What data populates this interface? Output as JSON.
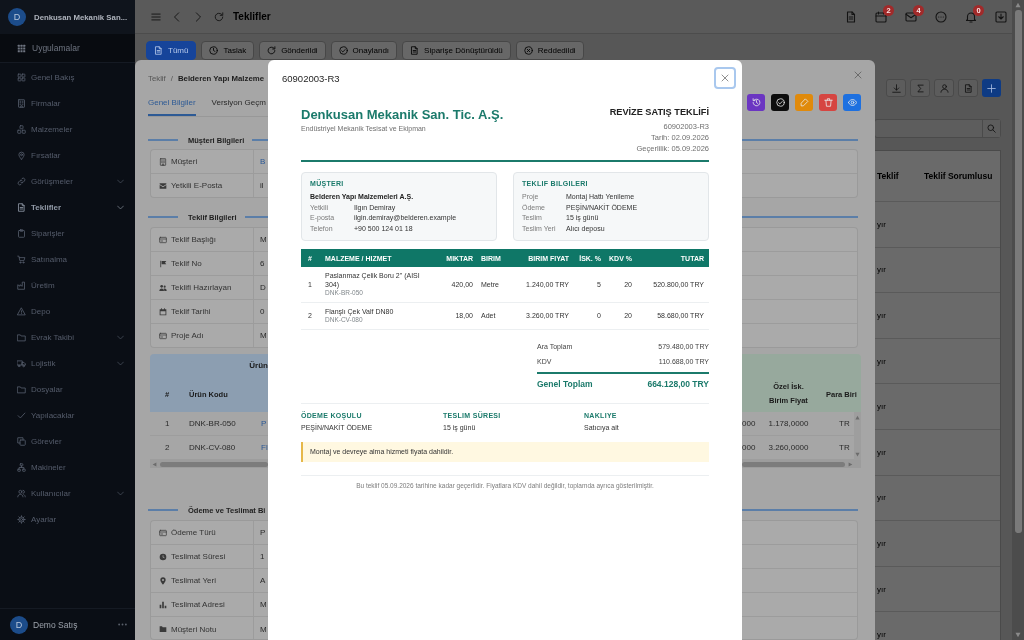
{
  "sidebar": {
    "brand": {
      "initial": "D",
      "name": "Denkusan Mekanik San..."
    },
    "apps_label": "Uygulamalar",
    "items": [
      {
        "label": "Genel Bakış",
        "selected": false,
        "has_submenu": false
      },
      {
        "label": "Firmalar",
        "selected": false,
        "has_submenu": false
      },
      {
        "label": "Malzemeler",
        "selected": false,
        "has_submenu": false
      },
      {
        "label": "Fırsatlar",
        "selected": false,
        "has_submenu": false
      },
      {
        "label": "Görüşmeler",
        "selected": false,
        "has_submenu": true
      },
      {
        "label": "Teklifler",
        "selected": true,
        "has_submenu": true
      },
      {
        "label": "Siparişler",
        "selected": false,
        "has_submenu": false
      },
      {
        "label": "Satınalma",
        "selected": false,
        "has_submenu": false
      },
      {
        "label": "Üretim",
        "selected": false,
        "has_submenu": false
      },
      {
        "label": "Depo",
        "selected": false,
        "has_submenu": false
      },
      {
        "label": "Evrak Takibi",
        "selected": false,
        "has_submenu": true
      },
      {
        "label": "Lojistik",
        "selected": false,
        "has_submenu": true
      },
      {
        "label": "Dosyalar",
        "selected": false,
        "has_submenu": false
      },
      {
        "label": "Yapılacaklar",
        "selected": false,
        "has_submenu": false
      },
      {
        "label": "Görevler",
        "selected": false,
        "has_submenu": false
      },
      {
        "label": "Makineler",
        "selected": false,
        "has_submenu": false
      },
      {
        "label": "Kullanıcılar",
        "selected": false,
        "has_submenu": true
      },
      {
        "label": "Ayarlar",
        "selected": false,
        "has_submenu": false
      }
    ],
    "user": {
      "initial": "D",
      "name": "Demo Satış"
    }
  },
  "topbar": {
    "title": "Teklifler",
    "badges": [
      "2",
      "4",
      "0"
    ]
  },
  "status_tabs": [
    {
      "label": "Tümü",
      "selected": true
    },
    {
      "label": "Taslak",
      "selected": false
    },
    {
      "label": "Gönderildi",
      "selected": false
    },
    {
      "label": "Onaylandı",
      "selected": false
    },
    {
      "label": "Siparişe Dönüştürüldü",
      "selected": false
    },
    {
      "label": "Reddedildi",
      "selected": false
    }
  ],
  "quote_list": {
    "columns": [
      "Teklif",
      "Teklif Sorumlusu"
    ],
    "rows": [
      {
        "cells": [
          "yır"
        ]
      },
      {
        "cells": [
          "yır"
        ]
      },
      {
        "cells": [
          "yır"
        ]
      },
      {
        "cells": [
          "yır"
        ]
      },
      {
        "cells": [
          "yır"
        ]
      },
      {
        "cells": [
          "yır"
        ]
      },
      {
        "cells": [
          "yır"
        ]
      },
      {
        "cells": [
          "yır"
        ]
      },
      {
        "cells": [
          "yır"
        ]
      },
      {
        "cells": [
          "yır"
        ]
      }
    ]
  },
  "drawer": {
    "breadcrumb": {
      "root": "Teklif",
      "separator": "/",
      "current": "Belderen Yapı Malzeme"
    },
    "tabs": [
      {
        "label": "Genel Bilgiler",
        "selected": true
      },
      {
        "label": "Versiyon Geçm",
        "selected": false
      }
    ],
    "action_buttons": [
      {
        "color": "#6b35c2"
      },
      {
        "color": "#0d0d0d"
      },
      {
        "color": "#e08a0b"
      },
      {
        "color": "#d64541"
      },
      {
        "color": "#1d70e0"
      }
    ],
    "sections": [
      {
        "title": "Müşteri Bilgileri",
        "fields": [
          {
            "label": "Müşteri",
            "value": "B",
            "link": true
          },
          {
            "label": "Yetkili E-Posta",
            "value": "il",
            "link": false
          }
        ]
      },
      {
        "title": "Teklif Bilgileri",
        "fields": [
          {
            "label": "Teklif Başlığı",
            "value": "M",
            "link": false
          },
          {
            "label": "Teklif No",
            "value": "6",
            "link": false
          },
          {
            "label": "Teklifi Hazırlayan",
            "value": "D",
            "link": false
          },
          {
            "label": "Teklif Tarihi",
            "value": "0",
            "link": false
          },
          {
            "label": "Proje Adı",
            "value": "M",
            "link": false
          }
        ]
      }
    ],
    "products": {
      "title": "Ürün",
      "columns": [
        "#",
        "Ürün Kodu",
        "Özel İsk. Birim Fiyat",
        "Para Biri"
      ],
      "rows": [
        {
          "no": "1",
          "code": "DNK-BR-050",
          "column_3": "P",
          "column_4": "000",
          "special_price": "1.178,0000",
          "currency": "TR"
        },
        {
          "no": "2",
          "code": "DNK-CV-080",
          "column_3": "Fl",
          "column_4": "000",
          "special_price": "3.260,0000",
          "currency": "TR"
        }
      ]
    },
    "payment_section": {
      "title": "Ödeme ve Teslimat Bi",
      "fields": [
        {
          "label": "Ödeme Türü",
          "value": "P",
          "link": false
        },
        {
          "label": "Teslimat Süresi",
          "value": "1",
          "link": false
        },
        {
          "label": "Teslimat Yeri",
          "value": "A",
          "link": false
        },
        {
          "label": "Teslimat Adresi",
          "value": "M",
          "link": false
        },
        {
          "label": "Müşteri Notu",
          "value": "M",
          "link": false
        }
      ]
    }
  },
  "modal": {
    "title": "60902003-R3",
    "company": {
      "name": "Denkusan Mekanik San. Tic. A.Ş.",
      "tagline": "Endüstriyel Mekanik Tesisat ve Ekipman"
    },
    "document": {
      "title": "REVİZE SATIŞ TEKLİFİ",
      "number": "60902003-R3",
      "date": "Tarih: 02.09.2026",
      "validity": "Geçerlilik: 05.09.2026"
    },
    "info_cards": [
      {
        "title": "MÜŞTERI",
        "headline": "Belderen Yapı Malzemeleri A.Ş.",
        "rows": [
          {
            "label": "Yetkili",
            "value": "Ilgın Demiray"
          },
          {
            "label": "E-posta",
            "value": "ilgin.demiray@belderen.example"
          },
          {
            "label": "Telefon",
            "value": "+90 500 124 01 18"
          }
        ]
      },
      {
        "title": "TEKLIF BILGILERI",
        "rows": [
          {
            "label": "Proje",
            "value": "Montaj Hattı Yenileme"
          },
          {
            "label": "Ödeme",
            "value": "PEŞİN/NAKİT ÖDEME"
          },
          {
            "label": "Teslim",
            "value": "15 iş günü"
          },
          {
            "label": "Teslim Yeri",
            "value": "Alıcı deposu"
          }
        ]
      }
    ],
    "items_table": {
      "columns": [
        "#",
        "MALZEME / HIZMET",
        "MIKTAR",
        "BIRIM",
        "BIRIM FIYAT",
        "İSK. %",
        "KDV %",
        "TUTAR"
      ],
      "rows": [
        {
          "no": "1",
          "name": "Paslanmaz Çelik Boru 2\" (AISI 304)",
          "code": "DNK-BR-050",
          "quantity": "420,00",
          "unit": "Metre",
          "unit_price": "1.240,00 TRY",
          "discount": "5",
          "vat": "20",
          "total": "520.800,00 TRY"
        },
        {
          "no": "2",
          "name": "Flanşlı Çek Valf DN80",
          "code": "DNK-CV-080",
          "quantity": "18,00",
          "unit": "Adet",
          "unit_price": "3.260,00 TRY",
          "discount": "0",
          "vat": "20",
          "total": "58.680,00 TRY"
        }
      ]
    },
    "totals": [
      {
        "label": "Ara Toplam",
        "value": "579.480,00 TRY",
        "kind": "line"
      },
      {
        "label": "KDV",
        "value": "110.688,00 TRY",
        "kind": "line"
      },
      {
        "label": "Genel Toplam",
        "value": "664.128,00 TRY",
        "kind": "grand"
      }
    ],
    "terms": [
      {
        "label": "ÖDEME KOŞULU",
        "value": "PEŞİN/NAKİT ÖDEME"
      },
      {
        "label": "TESLIM SÜRESI",
        "value": "15 iş günü"
      },
      {
        "label": "NAKLIYE",
        "value": "Satıcıya ait"
      }
    ],
    "note": "Montaj ve devreye alma hizmeti fiyata dahildir.",
    "footer": "Bu teklif 05.09.2026 tarihine kadar geçerlidir. Fiyatlara KDV dahil değildir, toplamda ayrıca gösterilmiştir."
  }
}
